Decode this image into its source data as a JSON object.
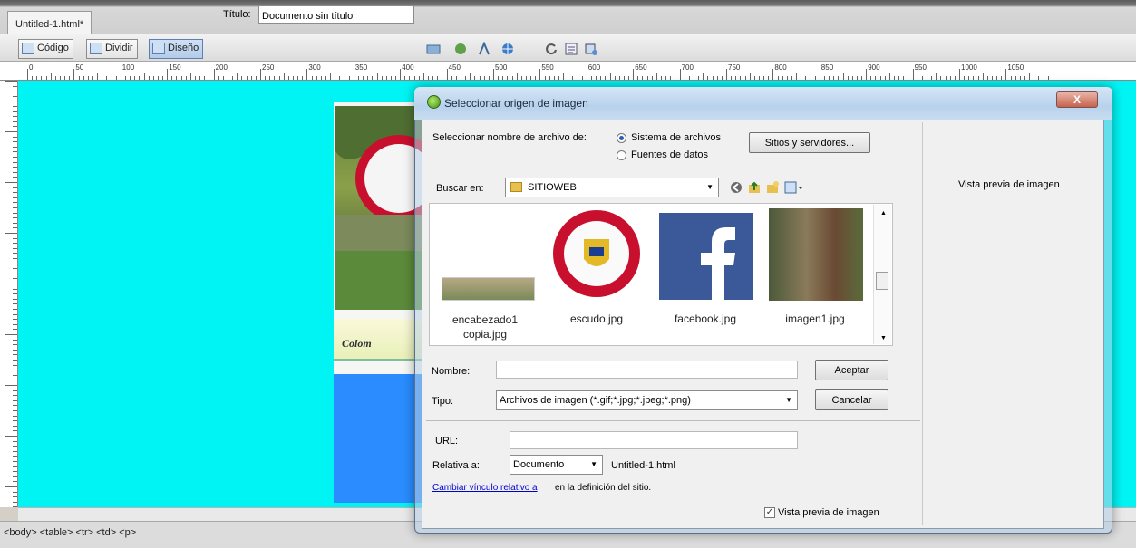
{
  "doc_tab": "Untitled-1.html*",
  "toolbar": {
    "code": "Código",
    "split": "Dividir",
    "design": "Diseño",
    "title_label": "Título:",
    "title_value": "Documento sin título"
  },
  "ruler_labels": [
    "0",
    "50",
    "100",
    "150",
    "200",
    "250",
    "300",
    "350",
    "400",
    "450",
    "500",
    "550",
    "600",
    "650",
    "700",
    "750",
    "800",
    "850",
    "900",
    "950",
    "1000",
    "1050"
  ],
  "canvas": {
    "band_text": "Colom"
  },
  "status_bar": {
    "tag_selector": "<body> <table> <tr> <td> <p>"
  },
  "dialog": {
    "title": "Seleccionar origen de imagen",
    "close": "X",
    "select_name_from": "Seleccionar nombre de archivo de:",
    "opt_filesystem": "Sistema de archivos",
    "opt_datasources": "Fuentes de datos",
    "sites_button": "Sitios y servidores...",
    "look_in_label": "Buscar en:",
    "look_in_value": "SITIOWEB",
    "files": [
      {
        "name": "encabezado1 copia.jpg"
      },
      {
        "name": "escudo.jpg"
      },
      {
        "name": "facebook.jpg"
      },
      {
        "name": "imagen1.jpg"
      }
    ],
    "name_label": "Nombre:",
    "name_value": "",
    "ok_button": "Aceptar",
    "type_label": "Tipo:",
    "type_value": "Archivos de imagen (*.gif;*.jpg;*.jpeg;*.png)",
    "cancel_button": "Cancelar",
    "url_label": "URL:",
    "url_value": "",
    "relative_label": "Relativa a:",
    "relative_value": "Documento",
    "relative_file": "Untitled-1.html",
    "change_link": "Cambiar vínculo relativo a",
    "change_link_tail": "en la definición del sitio.",
    "preview_checkbox": "Vista previa de imagen",
    "preview_label": "Vista previa de imagen"
  },
  "colors": {
    "canvas_bg": "#00f4f4",
    "blue_box": "#2a8cff",
    "link": "#0000cc"
  }
}
